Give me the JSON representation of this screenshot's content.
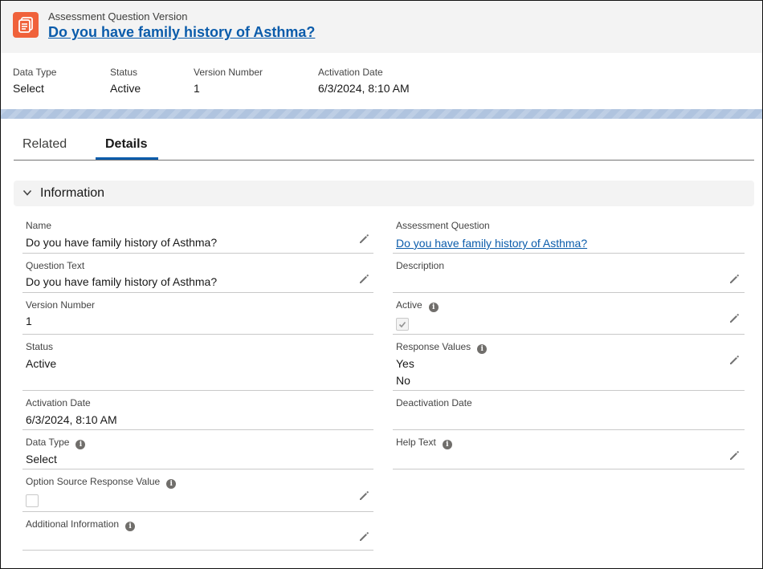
{
  "header": {
    "object_type": "Assessment Question Version",
    "title": "Do you have family history of Asthma?",
    "icon": "record-document-icon",
    "icon_color": "#f0623b"
  },
  "highlights": [
    {
      "label": "Data Type",
      "value": "Select"
    },
    {
      "label": "Status",
      "value": "Active"
    },
    {
      "label": "Version Number",
      "value": "1"
    },
    {
      "label": "Activation Date",
      "value": "6/3/2024, 8:10 AM"
    }
  ],
  "tabs": [
    {
      "label": "Related",
      "active": false
    },
    {
      "label": "Details",
      "active": true
    }
  ],
  "section": {
    "title": "Information",
    "expanded": true
  },
  "fields": {
    "name": {
      "label": "Name",
      "value": "Do you have family history of Asthma?"
    },
    "question_text": {
      "label": "Question Text",
      "value": "Do you have family history of Asthma?"
    },
    "version_number": {
      "label": "Version Number",
      "value": "1"
    },
    "status": {
      "label": "Status",
      "value": "Active"
    },
    "activation_date": {
      "label": "Activation Date",
      "value": "6/3/2024, 8:10 AM"
    },
    "data_type": {
      "label": "Data Type",
      "value": "Select"
    },
    "option_source": {
      "label": "Option Source Response Value",
      "checked": false
    },
    "additional_info": {
      "label": "Additional Information",
      "value": ""
    },
    "assessment_question": {
      "label": "Assessment Question",
      "value": "Do you have family history of Asthma?"
    },
    "description": {
      "label": "Description",
      "value": ""
    },
    "active": {
      "label": "Active",
      "checked": true
    },
    "response_values": {
      "label": "Response Values",
      "values": [
        "Yes",
        "No"
      ]
    },
    "deactivation_date": {
      "label": "Deactivation Date",
      "value": ""
    },
    "help_text": {
      "label": "Help Text",
      "value": ""
    }
  },
  "colors": {
    "link": "#0b5cab",
    "header_bg": "#f3f3f3",
    "band": "#b0c4df"
  }
}
